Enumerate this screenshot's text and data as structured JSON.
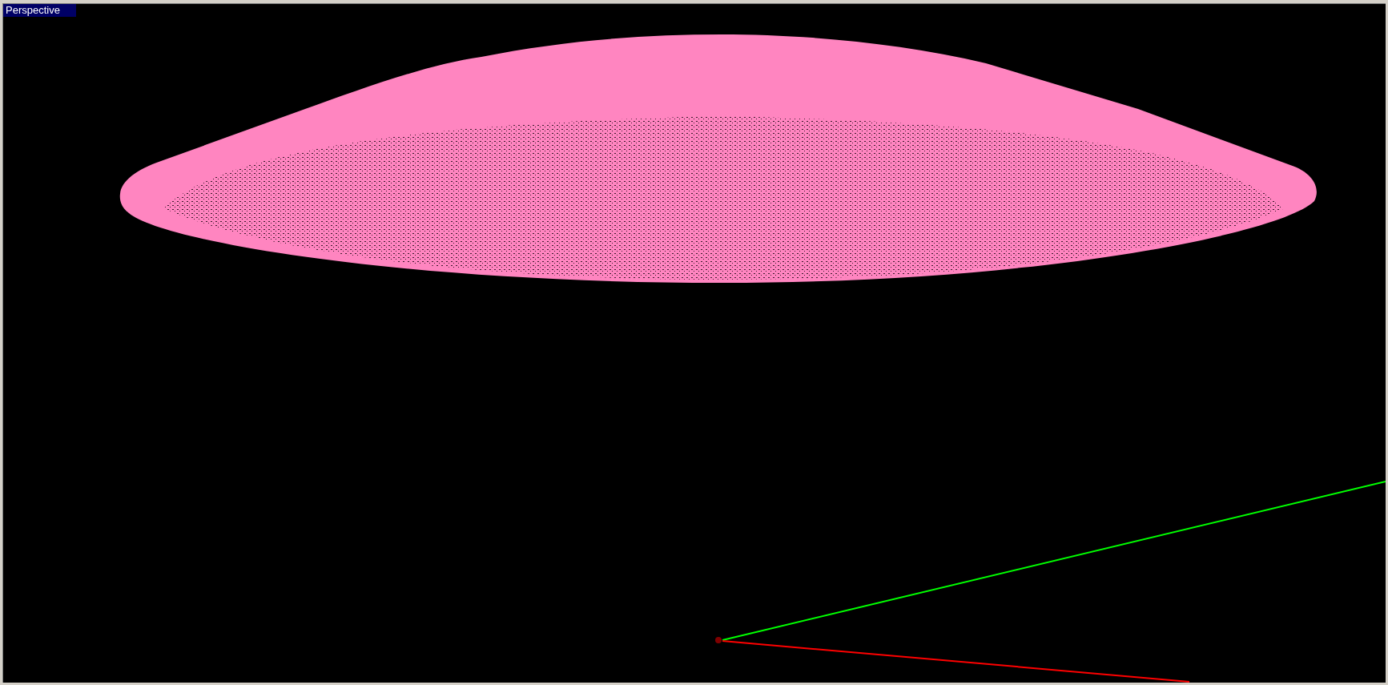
{
  "viewport": {
    "title": "Perspective",
    "active": true
  }
}
